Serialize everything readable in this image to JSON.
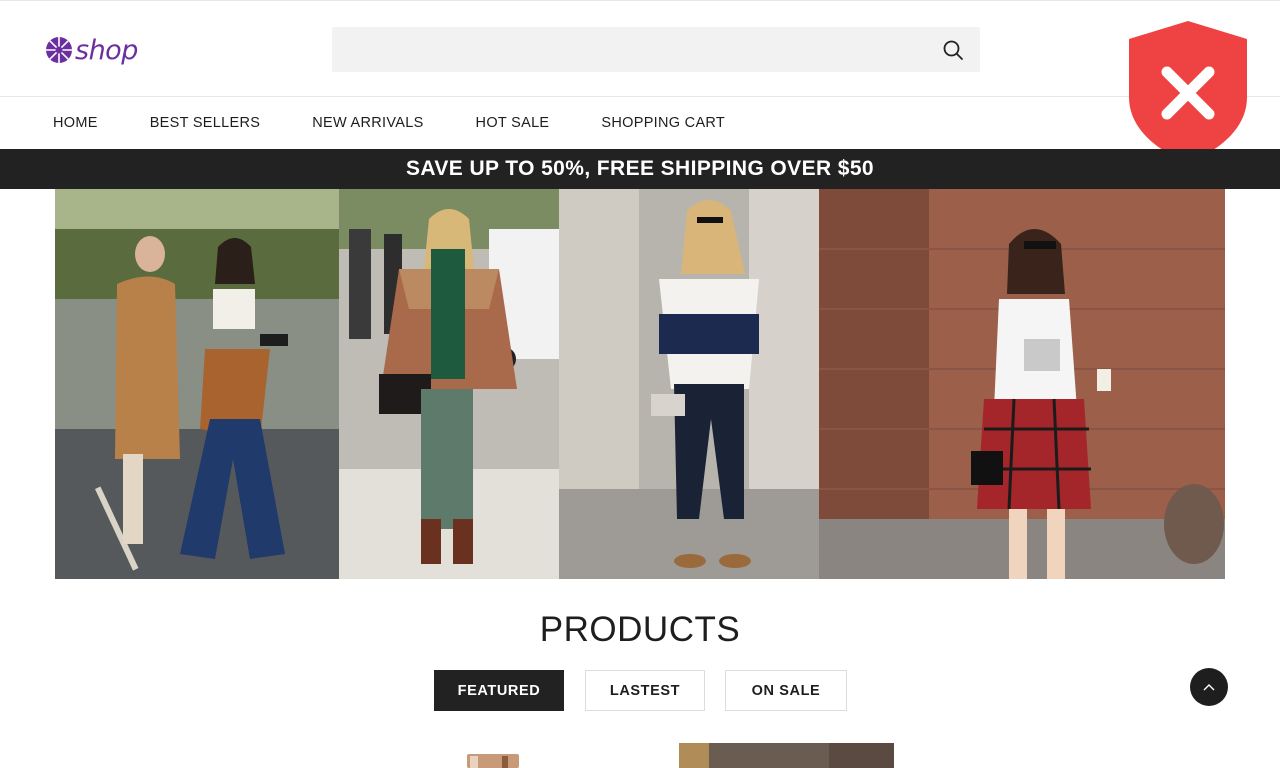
{
  "brand": {
    "logo_text": "shop",
    "logo_color": "#6b2fa0"
  },
  "search": {
    "placeholder": "",
    "icon": "search-icon"
  },
  "nav": {
    "items": [
      {
        "label": "HOME"
      },
      {
        "label": "BEST SELLERS"
      },
      {
        "label": "NEW ARRIVALS"
      },
      {
        "label": "HOT SALE"
      },
      {
        "label": "SHOPPING CART"
      }
    ]
  },
  "popup": {
    "icon": "shield-x-icon",
    "color": "#ef4343"
  },
  "promo": {
    "text": "SAVE UP TO 50%, FREE SHIPPING OVER $50"
  },
  "hero": {
    "image": "street-style-fashion-collage"
  },
  "products": {
    "title": "PRODUCTS",
    "tabs": [
      {
        "label": "FEATURED",
        "active": true
      },
      {
        "label": "LASTEST",
        "active": false
      },
      {
        "label": "ON SALE",
        "active": false
      }
    ]
  },
  "back_to_top": {
    "icon": "chevron-up-icon"
  },
  "colors": {
    "dark": "#222222",
    "search_bg": "#f2f2f2",
    "border": "#e6e6e6"
  }
}
